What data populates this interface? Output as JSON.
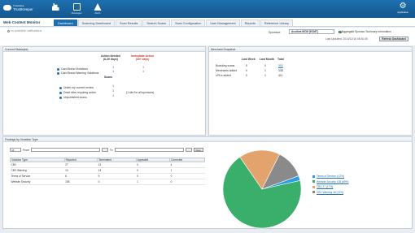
{
  "header": {
    "brand_line1": "Trustwave",
    "brand_line2": "TrustKeeper",
    "nav": [
      {
        "label": "",
        "icon": "bar-chart-icon"
      },
      {
        "label": "Messages",
        "icon": "message-icon"
      },
      {
        "label": "Alerts",
        "icon": "alert-icon"
      }
    ],
    "settings_label": "Application",
    "settings_icon": "gear-icon"
  },
  "subheader": {
    "title": "Web Content Monitor",
    "tabs": [
      "Dashboard",
      "Scanning Dashboard",
      "Scan Results",
      "Search Scans",
      "Scan Configuration",
      "User Management",
      "Reports",
      "Reference Library"
    ],
    "active_tab": "Dashboard"
  },
  "controls": {
    "available_text": "no available notifications",
    "sponsor_label": "Sponsor:",
    "sponsor_value": "Acuitiva MCM (ECMT)",
    "aggregate_label": "Aggregate Sponsor Summary Information",
    "aggregate_checked": true,
    "last_updated": "Last Updated: 2014/12/16 08:30:45",
    "refresh_label": "Refresh Dashboard"
  },
  "current_status": {
    "title": "Current Status(es)",
    "col1_line1": "Action Needed",
    "col1_line2": "(8-30 days)",
    "col2_line1": "Immediate Action",
    "col2_line2": "(30+ days)",
    "rows": [
      {
        "label": "Card Brand Violations",
        "v1": "1",
        "v2": "1"
      },
      {
        "label": "Card Brand Warning Violations",
        "v1": "1",
        "v2": "1"
      }
    ],
    "scans_title": "Scans",
    "scan_rows": [
      {
        "label": "Under my current review",
        "v1": "1",
        "v2": ""
      },
      {
        "label": "Dead sites requiring action",
        "v1": "1",
        "v2": "(1 site for all sponsors)"
      },
      {
        "label": "Unpublished scans",
        "v1": "1",
        "v2": ""
      }
    ]
  },
  "merchant_snapshot": {
    "title": "Merchant Snapshot",
    "headers": [
      "Last Week",
      "Last Month",
      "Total"
    ],
    "rows": [
      {
        "label": "Boarding scans",
        "values": [
          "0",
          "0",
          "300"
        ]
      },
      {
        "label": "Merchants added",
        "values": [
          "0",
          "1",
          "338"
        ]
      },
      {
        "label": "URLs added",
        "values": [
          "0",
          "1",
          "411"
        ]
      }
    ]
  },
  "findings": {
    "title": "Findings by Violation Type",
    "filter_select": "All",
    "from_label": "From",
    "to_label": "To",
    "view_label": "View",
    "table_headers": [
      "Violation Type",
      "Reported",
      "Terminated",
      "Appealed",
      "Corrected"
    ],
    "table_rows": [
      [
        "CBV",
        "27",
        "13",
        "0",
        "4"
      ],
      [
        "CBV Warning",
        "10",
        "13",
        "0",
        "1"
      ],
      [
        "Terms of Service",
        "6",
        "9",
        "0",
        "0"
      ],
      [
        "Website Security",
        "108",
        "0",
        "1",
        "0"
      ]
    ]
  },
  "chart_data": {
    "type": "pie",
    "title": "",
    "slices": [
      {
        "label": "Terms of Service 4 (2%)",
        "value": 2,
        "color": "#2f9be0"
      },
      {
        "label": "Website Security 108 (69%)",
        "value": 69,
        "color": "#3aae6b"
      },
      {
        "label": "CBV 27 (17%)",
        "value": 17,
        "color": "#e3a36d"
      },
      {
        "label": "CBV Warning 18 (12%)",
        "value": 12,
        "color": "#8a8a8a"
      }
    ],
    "legend_position": "right"
  }
}
